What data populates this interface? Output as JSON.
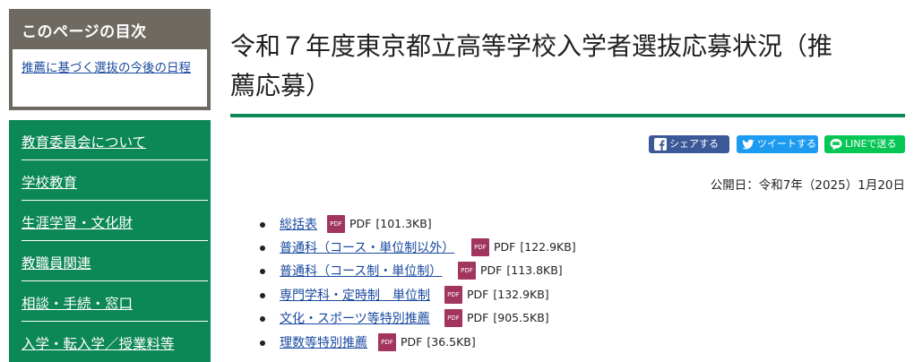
{
  "toc": {
    "title": "このページの目次",
    "link": "推薦に基づく選抜の今後の日程"
  },
  "nav": {
    "items": [
      "教育委員会について",
      "学校教育",
      "生涯学習・文化財",
      "教職員関連",
      "相談・手続・窓口",
      "入学・転入学／授業料等"
    ]
  },
  "page": {
    "title_line1": "令和７年度東京都立高等学校入学者選抜応募状況（推",
    "title_line2": "薦応募）",
    "published": "公開日：令和7年（2025）1月20日"
  },
  "share": {
    "facebook": "シェアする",
    "twitter": "ツイートする",
    "line": "LINEで送る"
  },
  "files": [
    {
      "label": "総括表",
      "icon": "PDF",
      "type": "PDF",
      "size": "[101.3KB]"
    },
    {
      "label": "普通科（コース・単位制以外）",
      "icon": "PDF",
      "type": "PDF",
      "size": "[122.9KB]"
    },
    {
      "label": "普通科（コース制・単位制）",
      "icon": "PDF",
      "type": "PDF",
      "size": "[113.8KB]"
    },
    {
      "label": "専門学科・定時制　単位制",
      "icon": "PDF",
      "type": "PDF",
      "size": "[132.9KB]"
    },
    {
      "label": "文化・スポーツ等特別推薦",
      "icon": "PDF",
      "type": "PDF",
      "size": "[905.5KB]"
    },
    {
      "label": "理数等特別推薦",
      "icon": "PDF",
      "type": "PDF",
      "size": "[36.5KB]"
    }
  ],
  "colors": {
    "accent_green": "#0c8756",
    "toc_gray": "#6e6a62",
    "link_blue": "#1a4aa0",
    "pdf_icon": "#a1355e"
  }
}
